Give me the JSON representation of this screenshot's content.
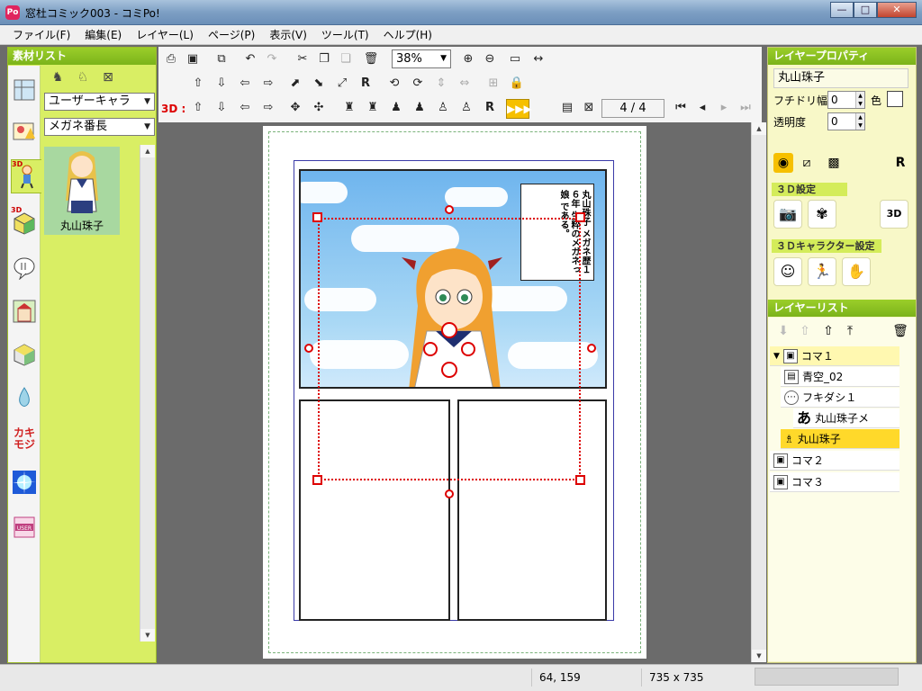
{
  "window": {
    "title": "窓杜コミック003 - コミPo!",
    "app_icon": "Po",
    "buttons": {
      "minimize": "—",
      "maximize": "□",
      "close": "✕"
    }
  },
  "menu": {
    "items": [
      "ファイル(F)",
      "編集(E)",
      "レイヤー(L)",
      "ページ(P)",
      "表示(V)",
      "ツール(T)",
      "ヘルプ(H)"
    ]
  },
  "left_panel": {
    "title": "素材リスト",
    "category_select": "ユーザーキャラ",
    "character_select": "メガネ番長",
    "asset": {
      "name": "丸山珠子"
    },
    "tool_3d_badge": "3D",
    "kaki_moji_label_1": "カキ",
    "kaki_moji_label_2": "モジ",
    "user_label": "USER"
  },
  "toolbar": {
    "zoom": "38%",
    "label_3d": "3D :",
    "page_indicator": "4 / 4",
    "ff_label": "▶▶▶"
  },
  "canvas": {
    "balloon_text": "丸山珠子 メガネ歴１６年 生粋のメガネっ娘 である。"
  },
  "right_panel": {
    "properties_title": "レイヤープロパティ",
    "layer_name": "丸山珠子",
    "outline_width_label": "フチドリ幅",
    "outline_width_value": "0",
    "color_label": "色",
    "opacity_label": "透明度",
    "opacity_value": "0",
    "settings_3d_title": "３Ｄ設定",
    "character_settings_title": "３Ｄキャラクター設定",
    "layers_title": "レイヤーリスト",
    "r_label": "R",
    "layers": [
      {
        "label": "コマ１"
      },
      {
        "label": "青空_02"
      },
      {
        "label": "フキダシ１"
      },
      {
        "label": "丸山珠子メ"
      },
      {
        "label": "丸山珠子"
      },
      {
        "label": "コマ２"
      },
      {
        "label": "コマ３"
      }
    ]
  },
  "status": {
    "coords": "64, 159",
    "size": "735 x 735"
  },
  "colors": {
    "panel_green": "#d9ee64",
    "header_green": "#7bb31a",
    "selection_red": "#d00000",
    "layer_selected": "#ffd92a"
  }
}
